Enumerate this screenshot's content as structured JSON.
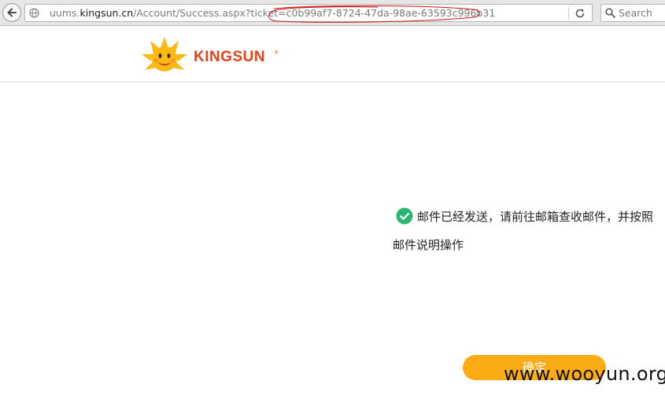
{
  "browser": {
    "url_prefix": "uums.",
    "url_domain": "kingsun.cn",
    "url_path": "/Account/Success.aspx?ticket=c0b99af7-8724-47da-98ae-63593c996b31",
    "search_placeholder": "Search"
  },
  "header": {
    "logo_text": "KINGSUN",
    "logo_reg": "®"
  },
  "main": {
    "message_line1": "邮件已经发送，请前往邮箱查收邮件，并按照",
    "message_line2": "邮件说明操作",
    "confirm_label": "确定"
  },
  "watermark": "www.wooyun.org",
  "colors": {
    "accent": "#fbab14",
    "brand": "#e8421b",
    "success": "#2bb571",
    "annotation": "#cc1111"
  }
}
